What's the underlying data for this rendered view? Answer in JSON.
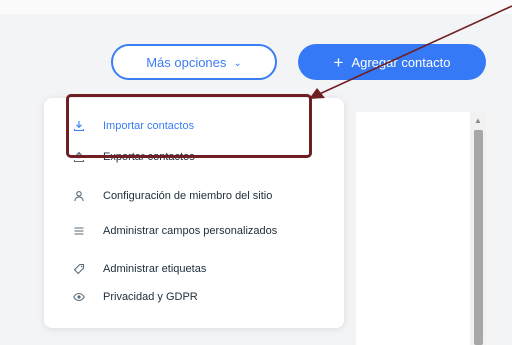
{
  "toolbar": {
    "more_options_label": "Más opciones",
    "add_contact_label": "Agregar contacto",
    "accent_color": "#3579f6"
  },
  "menu": {
    "items": [
      {
        "label": "Importar contactos",
        "icon": "import-icon",
        "active": true
      },
      {
        "label": "Exportar contactos",
        "icon": "export-icon",
        "active": false
      },
      {
        "label": "Configuración de miembro del sitio",
        "icon": "member-icon",
        "active": false
      },
      {
        "label": "Administrar campos personalizados",
        "icon": "list-icon",
        "active": false
      },
      {
        "label": "Administrar etiquetas",
        "icon": "tag-icon",
        "active": false
      },
      {
        "label": "Privacidad y GDPR",
        "icon": "privacy-eye-icon",
        "active": false
      }
    ]
  },
  "annotation": {
    "highlight_color": "#6f1e24",
    "arrow_color": "#6f1e24"
  }
}
